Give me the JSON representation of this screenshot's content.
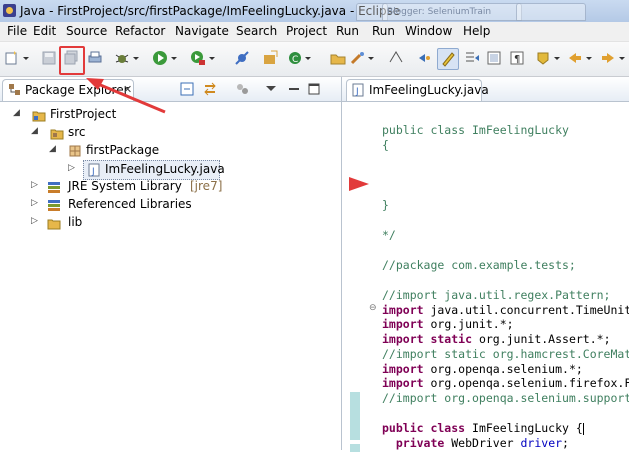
{
  "window": {
    "title": "Java - FirstProject/src/firstPackage/ImFeelingLucky.java - Eclipse",
    "background_tabs": [
      "",
      "Blogger: SeleniumTrain",
      ""
    ]
  },
  "menu": [
    "File",
    "Edit",
    "Source",
    "Refactor",
    "Navigate",
    "Search",
    "Project",
    "Run",
    "Run",
    "Window",
    "Help"
  ],
  "toolbar": {
    "icons": [
      "new-icon",
      "save-icon",
      "save-all-icon",
      "print-icon",
      "debug-icon",
      "run-icon",
      "run-external-icon",
      "skip-breakpoints-icon",
      "new-java-project-icon",
      "new-class-icon",
      "open-type-icon",
      "search-icon",
      "toggle-mark-icon",
      "highlight-icon",
      "next-annotation-icon",
      "show-whitespace-icon",
      "last-edit-icon",
      "back-icon",
      "forward-icon"
    ]
  },
  "package_explorer": {
    "tab_label": "Package Explorer",
    "close": "✕",
    "tree": [
      {
        "label": "FirstProject",
        "icon": "project-icon",
        "expanded": true
      },
      {
        "label": "src",
        "icon": "source-folder-icon",
        "expanded": true
      },
      {
        "label": "firstPackage",
        "icon": "package-icon",
        "expanded": true
      },
      {
        "label": "ImFeelingLucky.java",
        "icon": "java-file-icon",
        "expanded": false,
        "selected": true
      },
      {
        "label": "JRE System Library",
        "tag": "[jre7]",
        "icon": "library-icon",
        "expanded": false
      },
      {
        "label": "Referenced Libraries",
        "icon": "library-icon",
        "expanded": false
      },
      {
        "label": "lib",
        "icon": "folder-icon",
        "expanded": false
      }
    ]
  },
  "editor": {
    "tab_label": "ImFeelingLucky.java",
    "lines": [
      {
        "text": "public class ImFeelingLucky",
        "style": "comment"
      },
      {
        "text": "{",
        "style": "comment"
      },
      {
        "text": "}",
        "style": "comment"
      },
      {
        "text": "*/",
        "style": "comment"
      },
      {
        "text": "//package com.example.tests;",
        "style": "comment"
      },
      {
        "text": "//import java.util.regex.Pattern;",
        "style": "comment"
      },
      {
        "kw": "import",
        "rest": " java.util.concurrent.TimeUnit"
      },
      {
        "kw": "import",
        "rest": " org.junit.*;"
      },
      {
        "kw": "import static",
        "rest": " org.junit.Assert.*;"
      },
      {
        "text": "//import static org.hamcrest.CoreMat",
        "style": "comment"
      },
      {
        "kw": "import",
        "rest": " org.openqa.selenium.*;"
      },
      {
        "kw": "import",
        "rest": " org.openqa.selenium.firefox.F"
      },
      {
        "text": "//import org.openqa.selenium.support",
        "style": "comment"
      },
      {
        "kw": "public class",
        "rest": " ImFeelingLucky {"
      },
      {
        "kw": "private",
        "rest": " WebDriver ",
        "field": "driver",
        "tail": ";"
      }
    ],
    "fold_marker": "⊖"
  },
  "colors": {
    "annotation_red": "#e23a3a",
    "comment_green": "#3f7f5f",
    "keyword_purple": "#7f0055",
    "field_blue": "#0000c0"
  }
}
